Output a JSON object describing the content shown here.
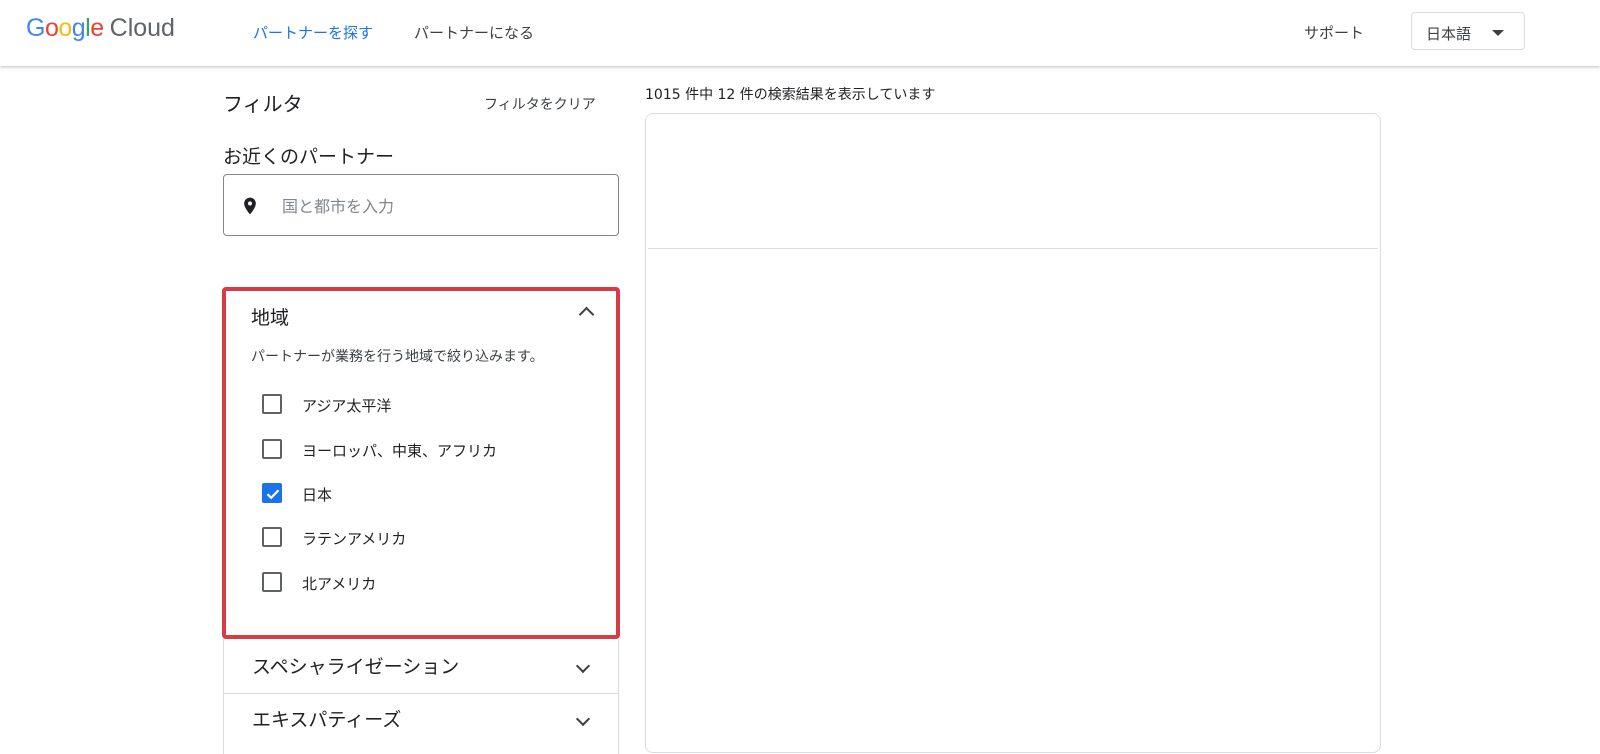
{
  "header": {
    "logo_google_letters": [
      {
        "ch": "G",
        "color": "#4285F4"
      },
      {
        "ch": "o",
        "color": "#EA4335"
      },
      {
        "ch": "o",
        "color": "#FBBC05"
      },
      {
        "ch": "g",
        "color": "#4285F4"
      },
      {
        "ch": "l",
        "color": "#34A853"
      },
      {
        "ch": "e",
        "color": "#EA4335"
      }
    ],
    "logo_cloud": "Cloud",
    "nav": [
      {
        "label": "パートナーを探す",
        "active": true
      },
      {
        "label": "パートナーになる",
        "active": false
      }
    ],
    "support_label": "サポート",
    "language": {
      "selected": "日本語",
      "icon": "caret-down-icon"
    }
  },
  "filters": {
    "title": "フィルタ",
    "clear_label": "フィルタをクリア",
    "nearby": {
      "label": "お近くのパートナー",
      "placeholder": "国と都市を入力",
      "value": "",
      "icon": "location-pin-icon"
    },
    "region": {
      "title": "地域",
      "expanded": true,
      "description": "パートナーが業務を行う地域で絞り込みます。",
      "options": [
        {
          "label": "アジア太平洋",
          "checked": false
        },
        {
          "label": "ヨーロッパ、中東、アフリカ",
          "checked": false
        },
        {
          "label": "日本",
          "checked": true
        },
        {
          "label": "ラテンアメリカ",
          "checked": false
        },
        {
          "label": "北アメリカ",
          "checked": false
        }
      ],
      "highlight_color": "#d93b45"
    },
    "sections": [
      {
        "title": "スペシャライゼーション",
        "expanded": false
      },
      {
        "title": "エキスパティーズ",
        "expanded": false
      }
    ]
  },
  "results": {
    "count_text": "1015 件中 12 件の検索結果を表示しています"
  },
  "colors": {
    "accent": "#1a73e8",
    "highlight": "#d93b45"
  }
}
